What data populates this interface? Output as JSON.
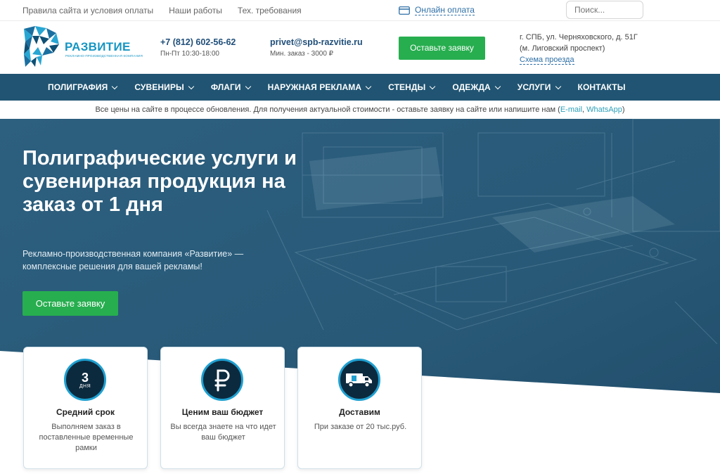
{
  "topbar": {
    "links": [
      "Правила сайта и условия оплаты",
      "Наши работы",
      "Тех. требования"
    ],
    "online_payment": "Онлайн оплата",
    "search_placeholder": "Поиск..."
  },
  "header": {
    "logo_name": "РАЗВИТИЕ",
    "logo_sub": "РЕКЛАМНО-ПРОИЗВОДСТВЕННАЯ КОМПАНИЯ",
    "phone": "+7 (812) 602-56-62",
    "hours": "Пн-Пт 10:30-18:00",
    "email": "privet@spb-razvitie.ru",
    "min_order": "Мин. заказ - 3000 ₽",
    "cta": "Оставьте заявку",
    "address_line1": "г. СПБ, ул. Черняховского, д. 51Г",
    "address_line2": "(м. Лиговский проспект)",
    "route": "Схема проезда"
  },
  "nav": {
    "items": [
      {
        "label": "ПОЛИГРАФИЯ",
        "dropdown": true
      },
      {
        "label": "СУВЕНИРЫ",
        "dropdown": true
      },
      {
        "label": "ФЛАГИ",
        "dropdown": true
      },
      {
        "label": "НАРУЖНАЯ РЕКЛАМА",
        "dropdown": true
      },
      {
        "label": "СТЕНДЫ",
        "dropdown": true
      },
      {
        "label": "ОДЕЖДА",
        "dropdown": true
      },
      {
        "label": "УСЛУГИ",
        "dropdown": true
      },
      {
        "label": "КОНТАКТЫ",
        "dropdown": false
      }
    ]
  },
  "notice": {
    "text": "Все цены на сайте в процессе обновления. Для получения актуальной стоимости - оставьте заявку на сайте или напишите нам (",
    "email_link": "E-mail",
    "separator": ", ",
    "whatsapp_link": "WhatsApp",
    "end": ")"
  },
  "hero": {
    "title": "Полиграфические услуги и сувенирная продукция на заказ от 1 дня",
    "subtitle": "Рекламно-производственная компания «Развитие» — комплексные решения для вашей рекламы!",
    "cta": "Оставьте заявку"
  },
  "cards": [
    {
      "icon": "days-icon",
      "num": "3",
      "unit": "ДНЯ",
      "title": "Средний срок",
      "desc": "Выполняем заказ в поставленные временные рамки"
    },
    {
      "icon": "ruble-icon",
      "title": "Ценим ваш бюджет",
      "desc": "Вы всегда знаете на что идет ваш бюджет"
    },
    {
      "icon": "truck-icon",
      "title": "Доставим",
      "desc": "При заказе от 20 тыс.руб."
    }
  ],
  "colors": {
    "nav_bg": "#205472",
    "accent_green": "#27ae4f",
    "hero_bg": "#2a5b7a",
    "brand_blue": "#1595c3"
  }
}
